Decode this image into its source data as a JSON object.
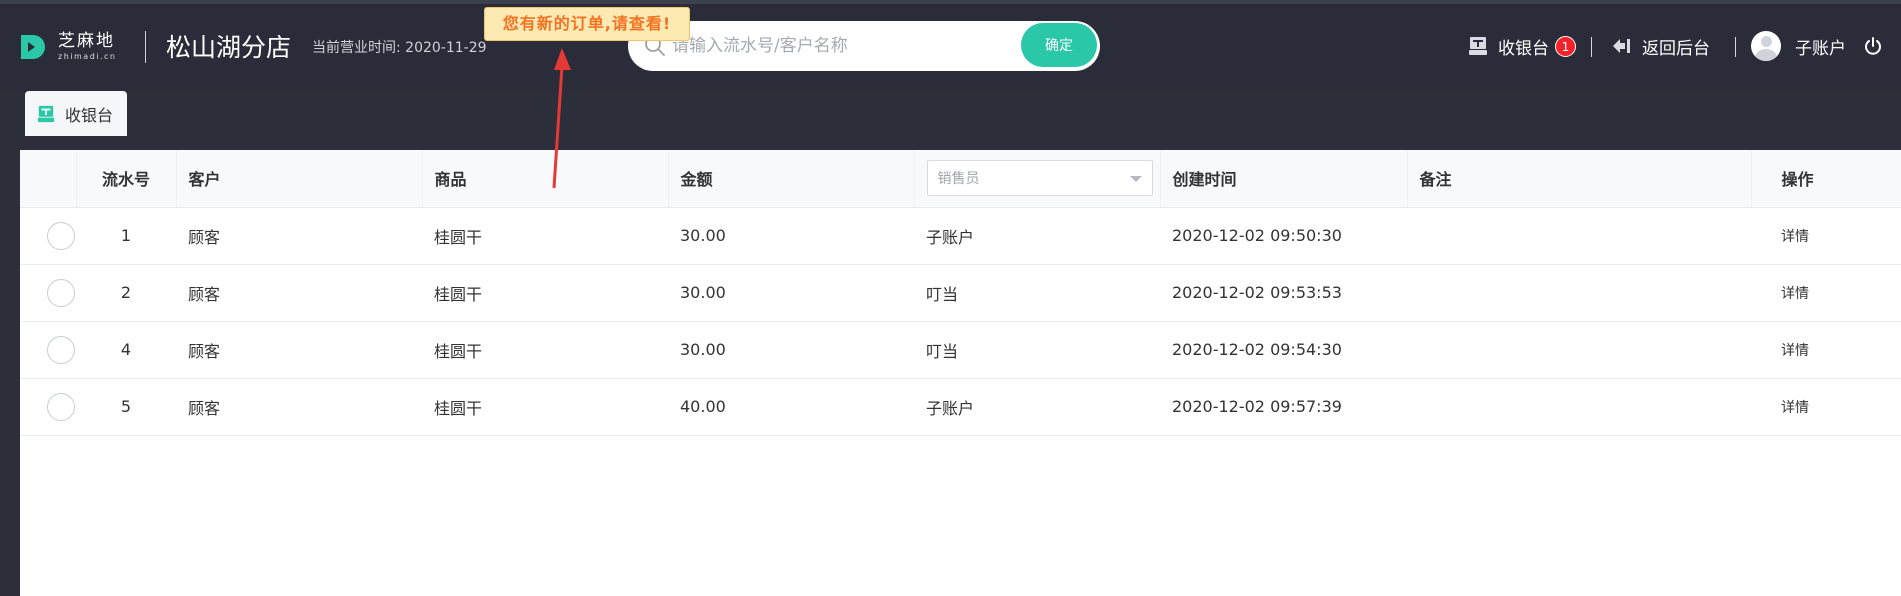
{
  "header": {
    "logo_cn": "芝麻地",
    "logo_en": "zhimadi.cn",
    "store_name": "松山湖分店",
    "business_time_label": "当前营业时间:",
    "business_time_value": "2020-11-29",
    "notification": "您有新的订单,请查看!",
    "search": {
      "placeholder": "请输入流水号/客户名称",
      "button_label": "确定"
    },
    "cashier_label": "收银台",
    "cashier_badge": "1",
    "back_label": "返回后台",
    "user_label": "子账户"
  },
  "tabs": [
    {
      "label": "收银台"
    }
  ],
  "table": {
    "columns": [
      "流水号",
      "客户",
      "商品",
      "金额",
      "销售员",
      "创建时间",
      "备注",
      "操作"
    ],
    "salesperson_placeholder": "销售员",
    "rows": [
      {
        "serial": "1",
        "customer": "顾客",
        "product": "桂圆干",
        "amount": "30.00",
        "salesperson": "子账户",
        "created": "2020-12-02 09:50:30",
        "note": "",
        "action": "详情"
      },
      {
        "serial": "2",
        "customer": "顾客",
        "product": "桂圆干",
        "amount": "30.00",
        "salesperson": "叮当",
        "created": "2020-12-02 09:53:53",
        "note": "",
        "action": "详情"
      },
      {
        "serial": "4",
        "customer": "顾客",
        "product": "桂圆干",
        "amount": "30.00",
        "salesperson": "叮当",
        "created": "2020-12-02 09:54:30",
        "note": "",
        "action": "详情"
      },
      {
        "serial": "5",
        "customer": "顾客",
        "product": "桂圆干",
        "amount": "40.00",
        "salesperson": "子账户",
        "created": "2020-12-02 09:57:39",
        "note": "",
        "action": "详情"
      }
    ]
  },
  "colors": {
    "topbar_bg": "#2a2d39",
    "accent": "#2bc7a9",
    "badge": "#f5222d",
    "notify_bg": "#fde9b2",
    "notify_text": "#f37323",
    "arrow": "#e53935"
  }
}
